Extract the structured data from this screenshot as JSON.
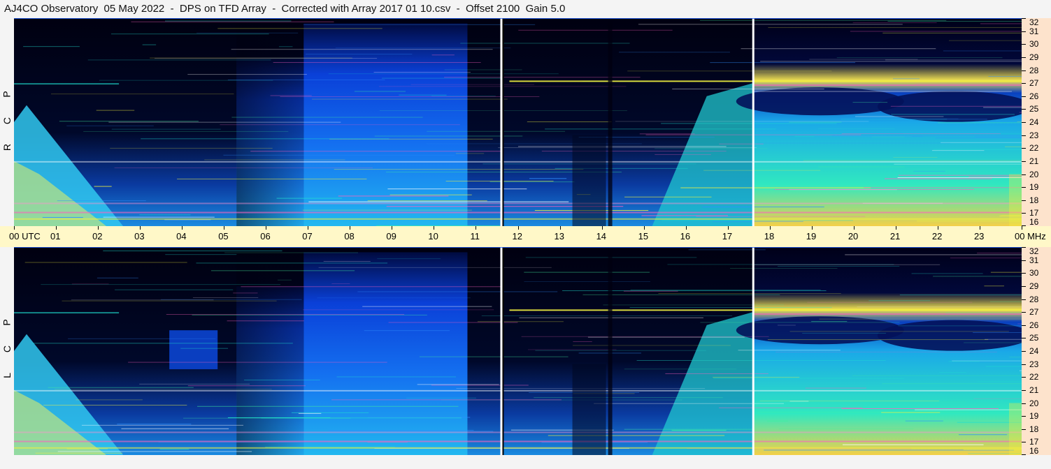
{
  "title": "AJ4CO Observatory  05 May 2022  -  DPS on TFD Array  -  Corrected with Array 2017 01 10.csv  -  Offset 2100  Gain 5.0",
  "polarization_labels": {
    "rcp": [
      "R",
      "C",
      "P"
    ],
    "lcp": [
      "L",
      "C",
      "P"
    ]
  },
  "chart_data": {
    "type": "heatmap",
    "panels": [
      "RCP",
      "LCP"
    ],
    "x_axis": {
      "unit": "UTC",
      "range_hours": [
        0,
        24
      ],
      "tick_labels": [
        "00 UTC",
        "01",
        "02",
        "03",
        "04",
        "05",
        "06",
        "07",
        "08",
        "09",
        "10",
        "11",
        "12",
        "13",
        "14",
        "15",
        "16",
        "17",
        "18",
        "19",
        "20",
        "21",
        "22",
        "23",
        "00 MHz"
      ]
    },
    "y_axis": {
      "unit": "MHz",
      "range": [
        16,
        32
      ],
      "tick_labels": [
        "32",
        "31",
        "30",
        "29",
        "28",
        "27",
        "26",
        "25",
        "24",
        "23",
        "22",
        "21",
        "20",
        "19",
        "18",
        "17",
        "16"
      ]
    },
    "markers_utc_hours": [
      11.6,
      17.6
    ],
    "colors": {
      "low": "#000012",
      "mid": "#1060ff",
      "high": "#20e0d0",
      "peak": "#f0f040",
      "rfi": "#ff60c0"
    }
  }
}
